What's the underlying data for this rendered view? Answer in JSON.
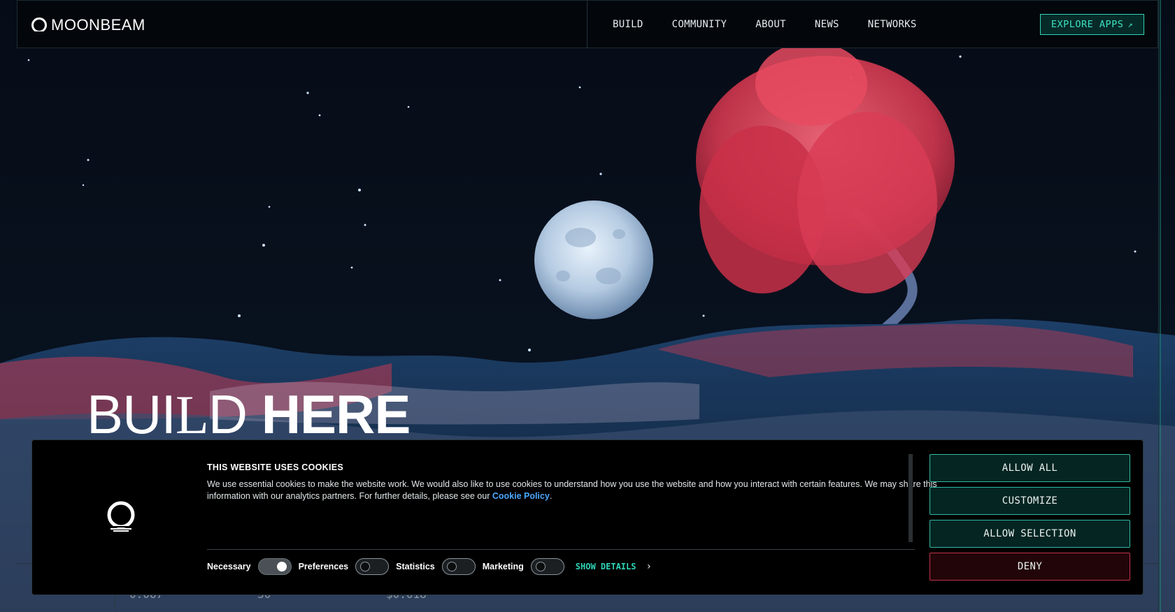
{
  "header": {
    "logo_text": "MOONBEAM",
    "nav": [
      "BUILD",
      "COMMUNITY",
      "ABOUT",
      "NEWS",
      "NETWORKS"
    ],
    "cta_label": "EXPLORE APPS",
    "cta_icon": "arrow-up-right-icon"
  },
  "hero": {
    "title_part1": "BUI",
    "title_part2": "L",
    "title_part3": "D ",
    "title_part4": "HERE"
  },
  "stats": {
    "values": [
      "0.067",
      "30",
      "$0.018"
    ]
  },
  "cookie": {
    "title": "THIS WEBSITE USES COOKIES",
    "text": "We use essential cookies to make the website work. We would also like to use cookies to understand how you use the website and how you interact with certain features. We may share this information with our analytics partners. For further details, please see our ",
    "link_text": "Cookie Policy",
    "text_end": ".",
    "consents": [
      {
        "label": "Necessary",
        "on": true
      },
      {
        "label": "Preferences",
        "on": false
      },
      {
        "label": "Statistics",
        "on": false
      },
      {
        "label": "Marketing",
        "on": false
      }
    ],
    "show_details": "SHOW DETAILS",
    "buttons": {
      "allow_all": "ALLOW ALL",
      "customize": "CUSTOMIZE",
      "allow_selection": "ALLOW SELECTION",
      "deny": "DENY"
    }
  },
  "colors": {
    "accent": "#2fd3b6",
    "deny": "#c2334a",
    "link": "#4aa8ff"
  }
}
